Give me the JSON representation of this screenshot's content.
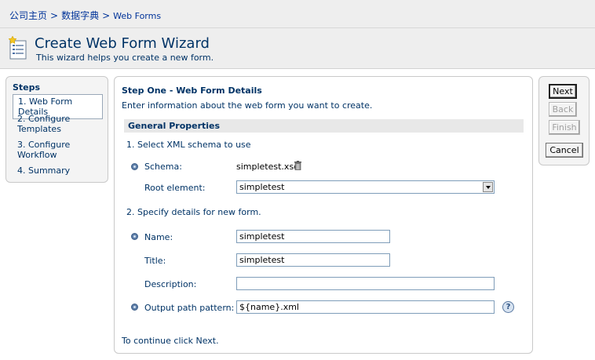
{
  "breadcrumb": {
    "home": "公司主页",
    "data_dictionary": "数据字典",
    "web_forms": "Web Forms"
  },
  "wizard": {
    "title": "Create Web Form Wizard",
    "description": "This wizard helps you create a new form."
  },
  "steps": {
    "heading": "Steps",
    "items": [
      {
        "label": "1. Web Form Details",
        "active": true
      },
      {
        "label": "2. Configure Templates",
        "line1": "2. Configure",
        "line2": "Templates"
      },
      {
        "label": "3. Configure Workflow",
        "line1": "3. Configure",
        "line2": "Workflow"
      },
      {
        "label": "4. Summary"
      }
    ]
  },
  "main": {
    "step_title": "Step One - Web Form Details",
    "step_description": "Enter information about the web form you want to create.",
    "section_header": "General Properties",
    "sub1": "1. Select XML schema to use",
    "schema_label": "Schema:",
    "schema_value": "simpletest.xsd",
    "root_label": "Root element:",
    "root_value": "simpletest",
    "sub2": "2. Specify details for new form.",
    "name_label": "Name:",
    "name_value": "simpletest",
    "title_label": "Title:",
    "title_value": "simpletest",
    "description_label": "Description:",
    "description_value": "",
    "output_label": "Output path pattern:",
    "output_value": "${name}.xml",
    "continue_text": "To continue click Next."
  },
  "buttons": {
    "next": "Next",
    "back": "Back",
    "finish": "Finish",
    "cancel": "Cancel"
  },
  "icons": {
    "wizard": "wizard-form-icon",
    "trash": "trash-icon",
    "help": "help-icon",
    "required": "required-bullet-icon"
  }
}
